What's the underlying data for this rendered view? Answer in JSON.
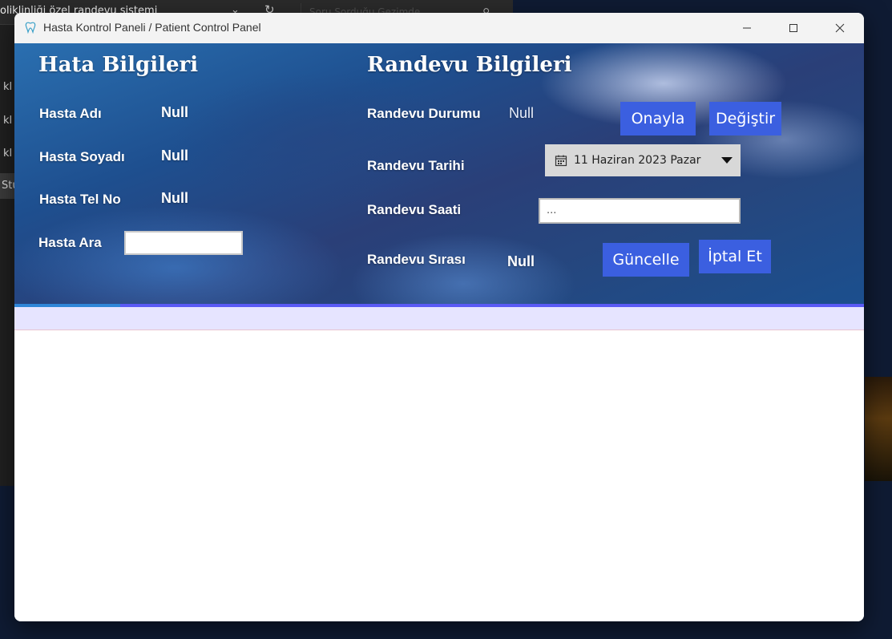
{
  "background_app": {
    "title": "oliklinliği özel randevu sistemi",
    "search_placeholder": "Soru Sorduğu Gezimde",
    "items": [
      "kl",
      "kl",
      "kl",
      "Stu"
    ]
  },
  "window": {
    "title": "Hasta Kontrol Paneli / Patient Control Panel"
  },
  "patient": {
    "section_title": "Hata Bilgileri",
    "name_label": "Hasta Adı",
    "name_value": "Null",
    "surname_label": "Hasta Soyadı",
    "surname_value": "Null",
    "phone_label": "Hasta Tel No",
    "phone_value": "Null",
    "search_label": "Hasta Ara",
    "search_value": ""
  },
  "appointment": {
    "section_title": "Randevu Bilgileri",
    "status_label": "Randevu Durumu",
    "status_value": "Null",
    "approve_button": "Onayla",
    "change_button": "Değiştir",
    "date_label": "Randevu Tarihi",
    "date_value": "11 Haziran 2023 Pazar",
    "time_label": "Randevu Saati",
    "time_value": "...",
    "order_label": "Randevu Sırası",
    "order_value": "Null",
    "update_button": "Güncelle",
    "cancel_button": "İptal Et"
  },
  "colors": {
    "button": "#3b5fe0",
    "grid_header": "#e6e4ff",
    "accent_bar": "#5a5af5"
  },
  "icons": {
    "app": "tooth-icon",
    "calendar": "calendar-icon",
    "dropdown": "caret-down-icon",
    "minimize": "minimize-icon",
    "maximize": "maximize-icon",
    "close": "close-icon"
  }
}
